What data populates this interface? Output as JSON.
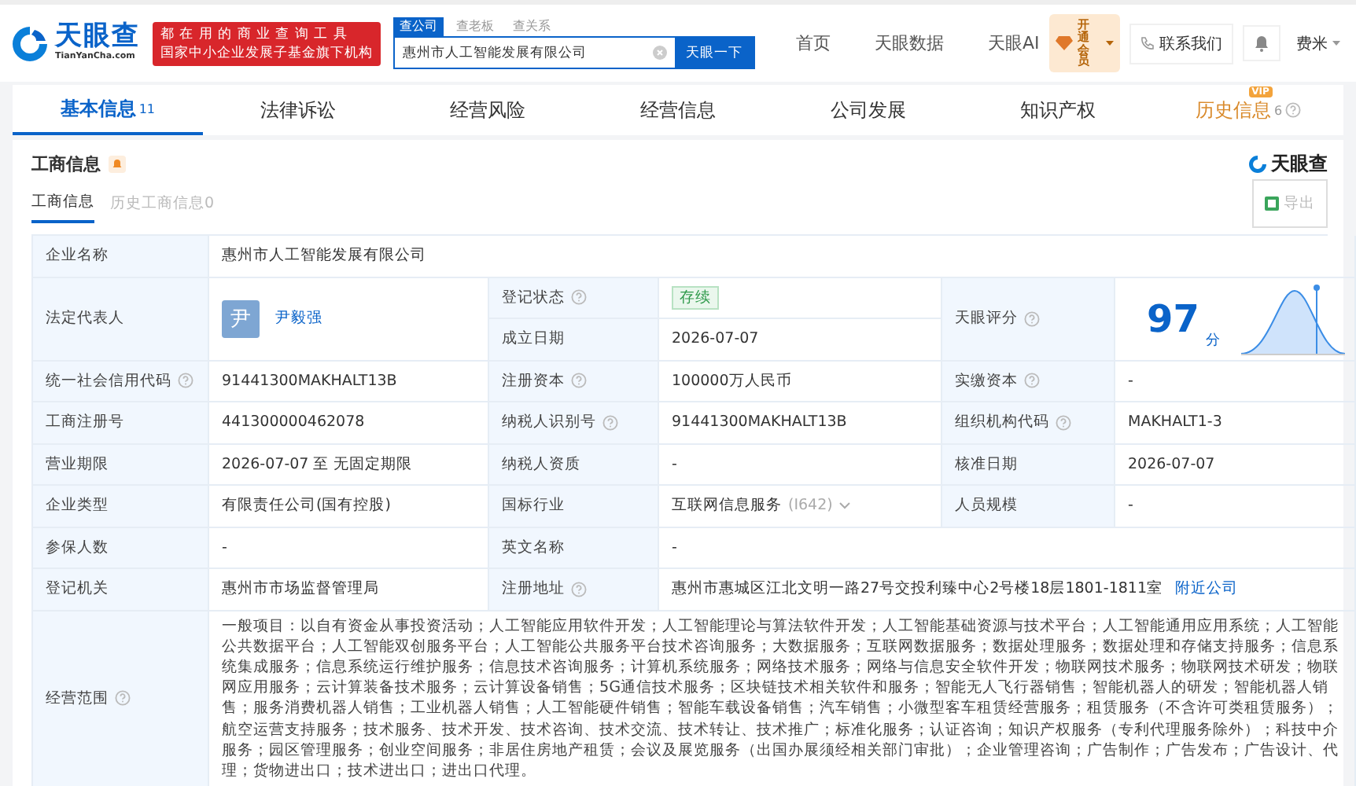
{
  "header": {
    "logo": "天眼查",
    "logo_sub": "TianYanCha.com",
    "slogan": [
      "都在用的商业查询工具",
      "国家中小企业发展子基金旗下机构"
    ],
    "search_tabs": [
      {
        "label": "查公司",
        "selected": true
      },
      {
        "label": "查老板",
        "selected": false
      },
      {
        "label": "查关系",
        "selected": false
      }
    ],
    "search_value": "惠州市人工智能发展有限公司",
    "search_button": "天眼一下",
    "nav": [
      "首页",
      "天眼数据",
      "天眼AI"
    ],
    "vip": "开通会员",
    "contact": "联系我们",
    "user": "费米"
  },
  "tabs": [
    {
      "label": "基本信息",
      "count": "11",
      "selected": true,
      "kind": "plain"
    },
    {
      "label": "法律诉讼",
      "selected": false,
      "kind": "plain"
    },
    {
      "label": "经营风险",
      "selected": false,
      "kind": "plain"
    },
    {
      "label": "经营信息",
      "selected": false,
      "kind": "plain"
    },
    {
      "label": "公司发展",
      "selected": false,
      "kind": "plain"
    },
    {
      "label": "知识产权",
      "selected": false,
      "kind": "plain"
    },
    {
      "label": "历史信息",
      "count": "6",
      "selected": false,
      "kind": "vip",
      "badge": "VIP"
    }
  ],
  "section": {
    "title": "工商信息",
    "brand": "天眼查",
    "subtabs": [
      {
        "label": "工商信息",
        "selected": true
      },
      {
        "label": "历史工商信息0",
        "selected": false
      }
    ],
    "export": "导出"
  },
  "table": {
    "rows": [
      [
        {
          "kind": "label",
          "text": "企业名称",
          "help": false
        },
        {
          "kind": "full",
          "text": "惠州市人工智能发展有限公司"
        }
      ],
      [
        {
          "kind": "tall_label",
          "text": "法定代表人",
          "help": false
        },
        {
          "kind": "person",
          "avatar": "尹",
          "name": "尹毅强"
        },
        {
          "kind": "label",
          "text": "登记状态",
          "help": true
        },
        {
          "kind": "status",
          "text": "存续"
        },
        {
          "kind": "tall_label",
          "text": "天眼评分",
          "help": true
        },
        {
          "kind": "score",
          "score": "97",
          "unit": "分"
        }
      ],
      [
        "",
        "",
        {
          "kind": "label",
          "text": "成立日期",
          "help": false
        },
        {
          "kind": "text",
          "text": "2026-07-07"
        }
      ],
      [
        {
          "kind": "label",
          "text": "统一社会信用代码",
          "help": true
        },
        {
          "kind": "text",
          "text": "91441300MAKHALT13B"
        },
        {
          "kind": "label",
          "text": "注册资本",
          "help": true
        },
        {
          "kind": "text",
          "text": "100000万人民币"
        },
        {
          "kind": "label",
          "text": "实缴资本",
          "help": true
        },
        {
          "kind": "text",
          "text": "-"
        }
      ],
      [
        {
          "kind": "label",
          "text": "工商注册号",
          "help": false
        },
        {
          "kind": "text",
          "text": "441300000462078"
        },
        {
          "kind": "label",
          "text": "纳税人识别号",
          "help": true
        },
        {
          "kind": "text",
          "text": "91441300MAKHALT13B"
        },
        {
          "kind": "label",
          "text": "组织机构代码",
          "help": true
        },
        {
          "kind": "text",
          "text": "MAKHALT1-3"
        }
      ],
      [
        {
          "kind": "label",
          "text": "营业期限",
          "help": false
        },
        {
          "kind": "text",
          "text": "2026-07-07 至 无固定期限"
        },
        {
          "kind": "label",
          "text": "纳税人资质",
          "help": false
        },
        {
          "kind": "text",
          "text": "-"
        },
        {
          "kind": "label",
          "text": "核准日期",
          "help": false
        },
        {
          "kind": "text",
          "text": "2026-07-07"
        }
      ],
      [
        {
          "kind": "label",
          "text": "企业类型",
          "help": false
        },
        {
          "kind": "text",
          "text": "有限责任公司(国有控股)"
        },
        {
          "kind": "label",
          "text": "国标行业",
          "help": false
        },
        {
          "kind": "industry",
          "text": "互联网信息服务",
          "code": "(I642)"
        },
        {
          "kind": "label",
          "text": "人员规模",
          "help": false
        },
        {
          "kind": "text",
          "text": "-"
        }
      ],
      [
        {
          "kind": "label",
          "text": "参保人数",
          "help": false
        },
        {
          "kind": "text",
          "text": "-"
        },
        {
          "kind": "label",
          "text": "英文名称",
          "help": false
        },
        {
          "kind": "wide",
          "text": "-"
        }
      ],
      [
        {
          "kind": "label",
          "text": "登记机关",
          "help": false
        },
        {
          "kind": "text",
          "text": "惠州市市场监督管理局"
        },
        {
          "kind": "label",
          "text": "注册地址",
          "help": true
        },
        {
          "kind": "address",
          "text": "惠州市惠城区江北文明一路27号交投利臻中心2号楼18层1801-1811室",
          "link": "附近公司"
        }
      ],
      [
        {
          "kind": "label",
          "text": "经营范围",
          "help": true
        },
        {
          "kind": "full",
          "text": "一般项目：以自有资金从事投资活动；人工智能应用软件开发；人工智能理论与算法软件开发；人工智能基础资源与技术平台；人工智能通用应用系统；人工智能公共数据平台；人工智能双创服务平台；人工智能公共服务平台技术咨询服务；大数据服务；互联网数据服务；数据处理服务；数据处理和存储支持服务；信息系统集成服务；信息系统运行维护服务；信息技术咨询服务；计算机系统服务；网络技术服务；网络与信息安全软件开发；物联网技术服务；物联网技术研发；物联网应用服务；云计算装备技术服务；云计算设备销售；5G通信技术服务；区块链技术相关软件和服务；智能无人飞行器销售；智能机器人的研发；智能机器人销售；服务消费机器人销售；工业机器人销售；人工智能硬件销售；智能车载设备销售；汽车销售；小微型客车租赁经营服务；租赁服务（不含许可类租赁服务）；航空运营支持服务；技术服务、技术开发、技术咨询、技术交流、技术转让、技术推广；标准化服务；认证咨询；知识产权服务（专利代理服务除外）；科技中介服务；园区管理服务；创业空间服务；非居住房地产租赁；会议及展览服务（出国办展须经相关部门审批）；企业管理咨询；广告制作；广告发布；广告设计、代理；货物进出口；技术进出口；进出口代理。"
        }
      ]
    ]
  }
}
